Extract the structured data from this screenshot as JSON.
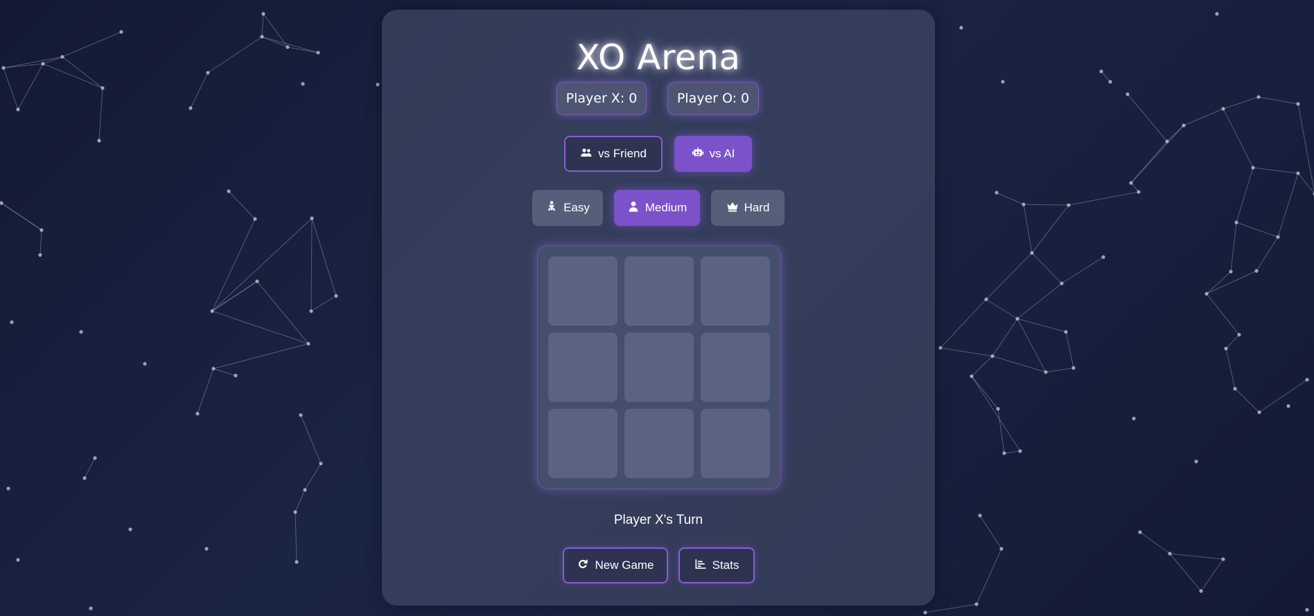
{
  "app": {
    "title": "XO Arena"
  },
  "scores": {
    "x": "Player X: 0",
    "o": "Player O: 0"
  },
  "modes": [
    {
      "label": "vs Friend",
      "icon": "users-icon",
      "active": false
    },
    {
      "label": "vs AI",
      "icon": "robot-icon",
      "active": true
    }
  ],
  "difficulty": [
    {
      "label": "Easy",
      "icon": "baby-icon",
      "active": false
    },
    {
      "label": "Medium",
      "icon": "person-icon",
      "active": true
    },
    {
      "label": "Hard",
      "icon": "crown-icon",
      "active": false
    }
  ],
  "board": {
    "cells": [
      "",
      "",
      "",
      "",
      "",
      "",
      "",
      "",
      ""
    ]
  },
  "status": "Player X's Turn",
  "actions": {
    "new_game": "New Game",
    "stats": "Stats"
  },
  "colors": {
    "accent": "#7b52c9",
    "accent_border": "#8b5cd6",
    "background": "#1a2445"
  }
}
